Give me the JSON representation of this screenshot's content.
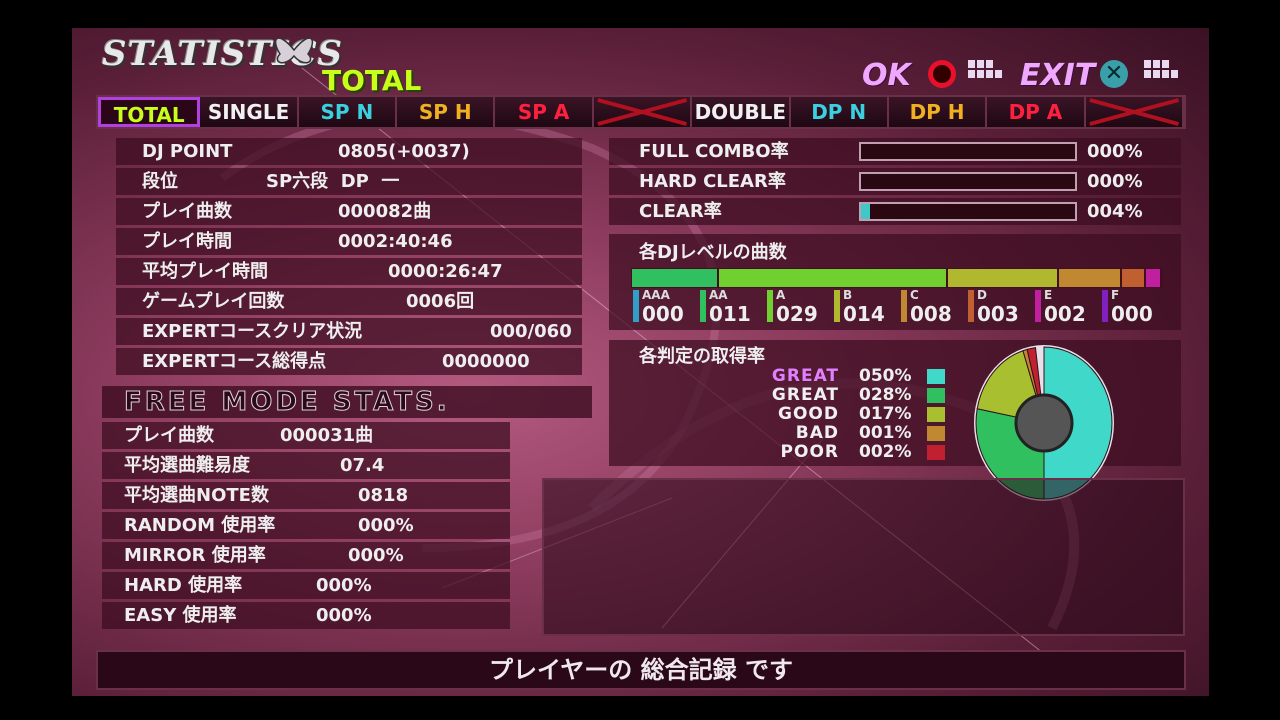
{
  "header": {
    "title": "STATISTICS",
    "subtitle": "TOTAL",
    "ok_label": "OK",
    "exit_label": "EXIT"
  },
  "tabs": [
    {
      "label": "TOTAL",
      "color": "#c8ff1a",
      "selected": true
    },
    {
      "label": "SINGLE",
      "color": "#f0f0f0"
    },
    {
      "label": "SP N",
      "color": "#3ad0e0"
    },
    {
      "label": "SP H",
      "color": "#f0b020"
    },
    {
      "label": "SP A",
      "color": "#ff2040"
    },
    {
      "label": "",
      "color": "#b01020",
      "disabled": true
    },
    {
      "label": "DOUBLE",
      "color": "#f0f0f0"
    },
    {
      "label": "DP N",
      "color": "#3ad0e0"
    },
    {
      "label": "DP H",
      "color": "#f0b020"
    },
    {
      "label": "DP A",
      "color": "#ff2040"
    },
    {
      "label": "",
      "color": "#b01020",
      "disabled": true
    }
  ],
  "player_stats": [
    {
      "label": "DJ POINT",
      "value": "0805(+0037)"
    },
    {
      "label": "段位",
      "value": "SP六段  DP  一"
    },
    {
      "label": "プレイ曲数",
      "value": "000082曲"
    },
    {
      "label": "プレイ時間",
      "value": "0002:40:46"
    },
    {
      "label": "平均プレイ時間",
      "value": "0000:26:47"
    },
    {
      "label": "ゲームプレイ回数",
      "value": "0006回"
    },
    {
      "label": "EXPERTコースクリア状況",
      "value": "000/060"
    },
    {
      "label": "EXPERTコース総得点",
      "value": "0000000"
    }
  ],
  "free_mode": {
    "title": "FREE MODE STATS.",
    "rows": [
      {
        "label": "プレイ曲数",
        "value": "000031曲"
      },
      {
        "label": "平均選曲難易度",
        "value": "07.4"
      },
      {
        "label": "平均選曲NOTE数",
        "value": "0818"
      },
      {
        "label": "RANDOM 使用率",
        "value": "000%"
      },
      {
        "label": "MIRROR 使用率",
        "value": "000%"
      },
      {
        "label": "HARD 使用率",
        "value": "000%"
      },
      {
        "label": "EASY 使用率",
        "value": "000%"
      }
    ]
  },
  "clear_rates": [
    {
      "label": "FULL COMBO率",
      "value": "000%",
      "fraction": 0.0
    },
    {
      "label": "HARD CLEAR率",
      "value": "000%",
      "fraction": 0.0
    },
    {
      "label": "CLEAR率",
      "value": "004%",
      "fraction": 0.04
    }
  ],
  "dj_levels": {
    "title": "各DJレベルの曲数",
    "items": [
      {
        "name": "AAA",
        "count": "000",
        "color": "#30a0c8"
      },
      {
        "name": "AA",
        "count": "011",
        "color": "#30c060"
      },
      {
        "name": "A",
        "count": "029",
        "color": "#70d030"
      },
      {
        "name": "B",
        "count": "014",
        "color": "#b0b830"
      },
      {
        "name": "C",
        "count": "008",
        "color": "#c08830"
      },
      {
        "name": "D",
        "count": "003",
        "color": "#c06030"
      },
      {
        "name": "E",
        "count": "002",
        "color": "#c020a0"
      },
      {
        "name": "F",
        "count": "000",
        "color": "#8020c0"
      }
    ]
  },
  "judgements": {
    "title": "各判定の取得率",
    "items": [
      {
        "name": "GREAT",
        "value": "050%",
        "color": "#40d8c8",
        "name_color": "#e080ff"
      },
      {
        "name": "GREAT",
        "value": "028%",
        "color": "#30c060",
        "name_color": "#f0f0f0"
      },
      {
        "name": "GOOD",
        "value": "017%",
        "color": "#a8c030",
        "name_color": "#f0f0f0"
      },
      {
        "name": "BAD",
        "value": "001%",
        "color": "#c08830",
        "name_color": "#f0f0f0"
      },
      {
        "name": "POOR",
        "value": "002%",
        "color": "#c02030",
        "name_color": "#f0f0f0"
      }
    ],
    "pie_fractions": [
      0.5,
      0.28,
      0.17,
      0.01,
      0.02
    ]
  },
  "footer": {
    "message": "プレイヤーの 総合記録 です"
  }
}
